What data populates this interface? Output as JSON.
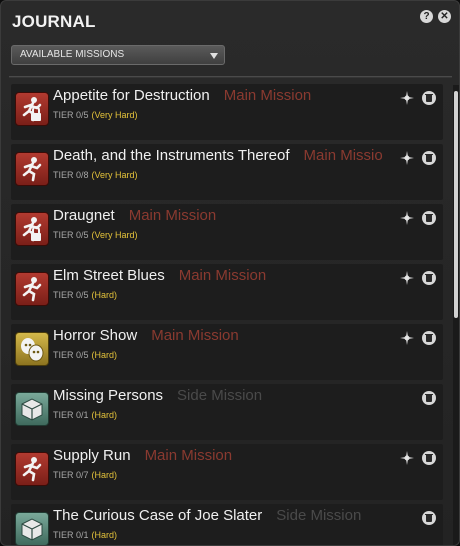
{
  "journal": {
    "title": "JOURNAL",
    "help_icon": "help-icon",
    "close_icon": "close-icon",
    "help_label": "?",
    "close_label": "✕"
  },
  "filter": {
    "selected": "AVAILABLE MISSIONS"
  },
  "missions": [
    {
      "name": "Appetite for Destruction",
      "type": "Main Mission",
      "tier_label": "TIER 0/5",
      "difficulty": "(Very Hard)",
      "icon": "main-mission-locked-icon",
      "locked": true,
      "trackable": true
    },
    {
      "name": "Death, and the Instruments Thereof",
      "type": "Main Missio",
      "tier_label": "TIER 0/8",
      "difficulty": "(Very Hard)",
      "icon": "main-mission-icon",
      "locked": false,
      "trackable": true
    },
    {
      "name": "Draugnet",
      "type": "Main Mission",
      "tier_label": "TIER 0/5",
      "difficulty": "(Very Hard)",
      "icon": "main-mission-locked-icon",
      "locked": true,
      "trackable": true
    },
    {
      "name": "Elm Street Blues",
      "type": "Main Mission",
      "tier_label": "TIER 0/5",
      "difficulty": "(Hard)",
      "icon": "main-mission-icon",
      "locked": false,
      "trackable": true
    },
    {
      "name": "Horror Show",
      "type": "Main Mission",
      "tier_label": "TIER 0/5",
      "difficulty": "(Hard)",
      "icon": "gold-mission-icon",
      "locked": false,
      "trackable": true
    },
    {
      "name": "Missing Persons",
      "type": "Side Mission",
      "tier_label": "TIER 0/1",
      "difficulty": "(Hard)",
      "icon": "side-mission-icon",
      "locked": false,
      "trackable": false
    },
    {
      "name": "Supply Run",
      "type": "Main Mission",
      "tier_label": "TIER 0/7",
      "difficulty": "(Hard)",
      "icon": "main-mission-icon",
      "locked": false,
      "trackable": true
    },
    {
      "name": "The Curious Case of Joe Slater",
      "type": "Side Mission",
      "tier_label": "TIER 0/1",
      "difficulty": "(Hard)",
      "icon": "side-mission-icon",
      "locked": false,
      "trackable": false
    }
  ],
  "colors": {
    "main_mission_type": "#8a3a30",
    "side_mission_type": "#4a4a4a",
    "difficulty": "#e3c23a"
  }
}
